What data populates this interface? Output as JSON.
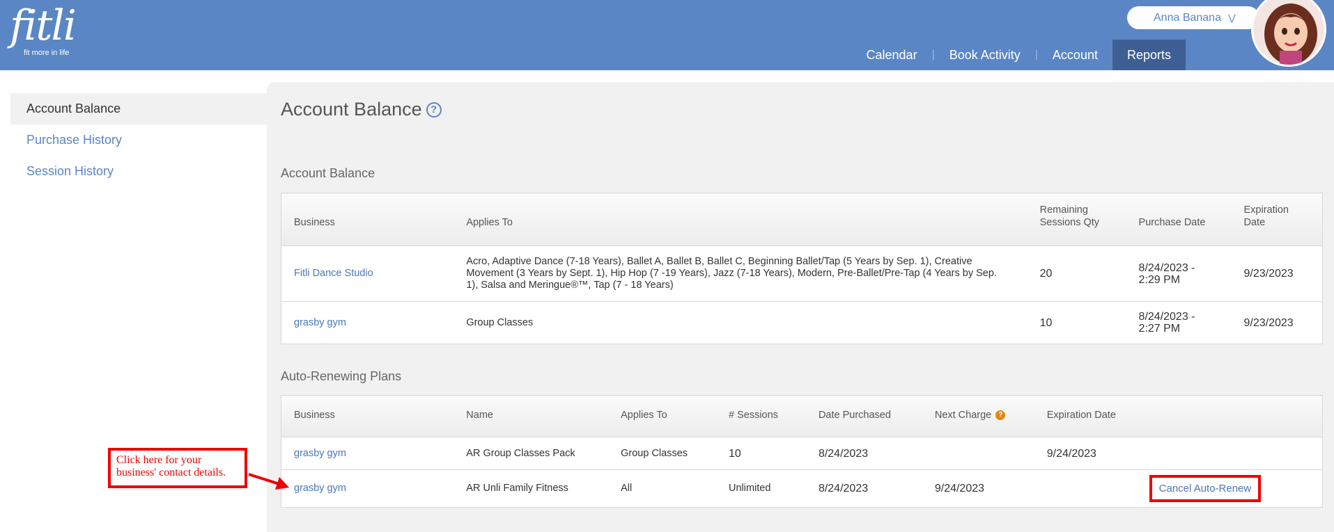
{
  "header": {
    "logo_text": "fitli",
    "logo_tagline": "fit more in life",
    "user_name": "Anna Banana",
    "nav": [
      "Calendar",
      "Book Activity",
      "Account",
      "Reports"
    ],
    "active_nav": "Reports"
  },
  "sidebar": {
    "items": [
      {
        "label": "Account Balance",
        "active": true
      },
      {
        "label": "Purchase History",
        "active": false
      },
      {
        "label": "Session History",
        "active": false
      }
    ]
  },
  "main": {
    "page_title": "Account Balance",
    "balance_section_title": "Account Balance",
    "balance_table": {
      "headers": [
        "Business",
        "Applies To",
        "Remaining\nSessions Qty",
        "Purchase Date",
        "Expiration\nDate"
      ],
      "rows": [
        {
          "business": "Fitli Dance Studio",
          "applies_to": "Acro, Adaptive Dance (7-18 Years), Ballet A, Ballet B, Ballet C, Beginning Ballet/Tap (5 Years by Sep. 1), Creative Movement (3 Years by Sept. 1), Hip Hop (7 -19 Years), Jazz (7-18 Years), Modern, Pre-Ballet/Pre-Tap (4 Years by Sep. 1), Salsa and Meringue®™, Tap (7 - 18 Years)",
          "remaining": "20",
          "purchase_date": "8/24/2023 - 2:29 PM",
          "expiration": "9/23/2023"
        },
        {
          "business": "grasby gym",
          "applies_to": "Group Classes",
          "remaining": "10",
          "purchase_date": "8/24/2023 - 2:27 PM",
          "expiration": "9/23/2023"
        }
      ]
    },
    "auto_section_title": "Auto-Renewing Plans",
    "auto_table": {
      "headers": [
        "Business",
        "Name",
        "Applies To",
        "# Sessions",
        "Date Purchased",
        "Next Charge",
        "Expiration Date",
        ""
      ],
      "rows": [
        {
          "business": "grasby gym",
          "name": "AR Group Classes Pack",
          "applies_to": "Group Classes",
          "sessions": "10",
          "date_purchased": "8/24/2023",
          "next_charge": "",
          "expiration": "9/24/2023",
          "action": ""
        },
        {
          "business": "grasby gym",
          "name": "AR Unli Family Fitness",
          "applies_to": "All",
          "sessions": "Unlimited",
          "date_purchased": "8/24/2023",
          "next_charge": "9/24/2023",
          "expiration": "",
          "action": "Cancel Auto-Renew"
        }
      ]
    }
  },
  "callout": {
    "text": "Click here for your business' contact details."
  },
  "colors": {
    "header_blue": "#5a86c5",
    "active_nav": "#3e5f94",
    "link": "#4a76b8",
    "annotation_red": "#e00000",
    "help_orange": "#e8850c"
  }
}
